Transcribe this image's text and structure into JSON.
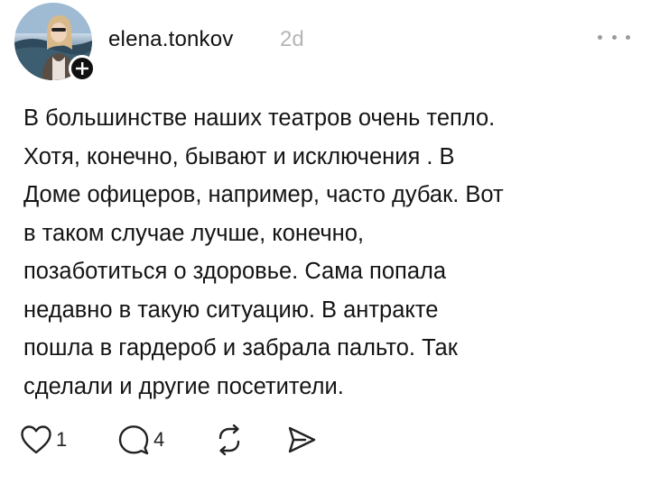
{
  "post": {
    "author": "elena.tonkov",
    "time_ago": "2d",
    "lines": [
      "В большинстве наших театров очень тепло.",
      "Хотя, конечно, бывают и исключения . В",
      "Доме офицеров, например, часто дубак. Вот",
      "в таком случае лучше, конечно,",
      "позаботиться о здоровье. Сама попала",
      "недавно в такую ситуацию. В антракте",
      "пошла в гардероб и забрала пальто. Так",
      "сделали и другие посетители."
    ]
  },
  "actions": {
    "likes": "1",
    "comments": "4",
    "like_icon": "heart-icon",
    "comment_icon": "speech-bubble-icon",
    "repost_icon": "repost-icon",
    "share_icon": "send-icon"
  },
  "colors": {
    "text": "#141414",
    "muted": "#b5b5b5",
    "icon": "#222222"
  }
}
